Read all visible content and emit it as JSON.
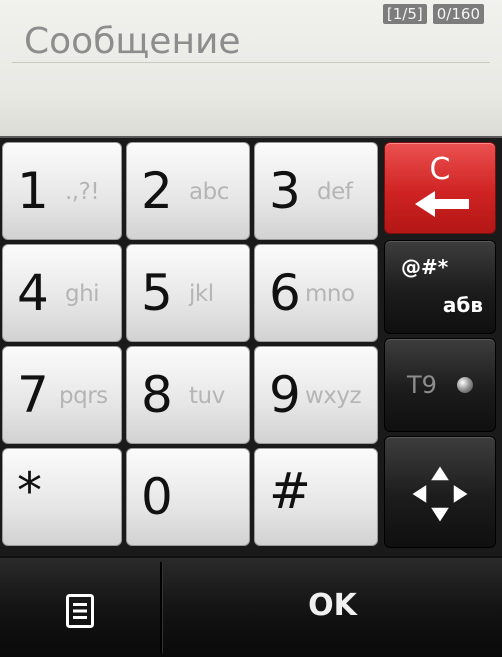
{
  "compose": {
    "placeholder": "Сообщение",
    "value": "",
    "segment": "[1/5]",
    "char_count": "0/160"
  },
  "keys": {
    "k1": {
      "digit": "1",
      "letters": ".,?!"
    },
    "k2": {
      "digit": "2",
      "letters": "abc"
    },
    "k3": {
      "digit": "3",
      "letters": "def"
    },
    "k4": {
      "digit": "4",
      "letters": "ghi"
    },
    "k5": {
      "digit": "5",
      "letters": "jkl"
    },
    "k6": {
      "digit": "6",
      "letters": "mno"
    },
    "k7": {
      "digit": "7",
      "letters": "pqrs"
    },
    "k8": {
      "digit": "8",
      "letters": "tuv"
    },
    "k9": {
      "digit": "9",
      "letters": "wxyz"
    },
    "star": {
      "digit": "*"
    },
    "k0": {
      "digit": "0"
    },
    "hash": {
      "digit": "#"
    }
  },
  "side_keys": {
    "clear": {
      "label": "C",
      "icon": "backspace-arrow-icon",
      "color": "#d32b2b"
    },
    "symbols": {
      "top": "@#*",
      "bottom": "абв"
    },
    "t9": {
      "label": "T9",
      "icon": "t9-indicator-dot-icon"
    },
    "nav": {
      "icon": "directional-arrows-icon"
    }
  },
  "bottom_bar": {
    "menu_icon": "list-menu-icon",
    "ok_label": "OK"
  }
}
